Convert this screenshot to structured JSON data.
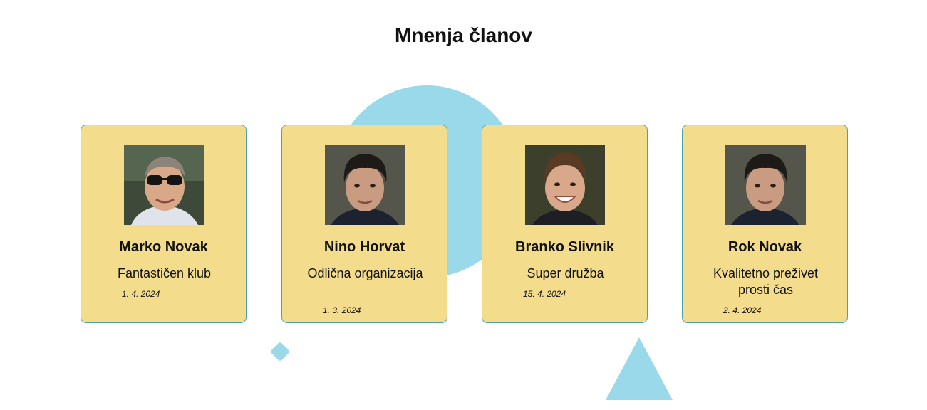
{
  "section": {
    "title": "Mnenja članov"
  },
  "testimonials": [
    {
      "name": "Marko Novak",
      "comment": "Fantastičen klub",
      "date": "1. 4. 2024",
      "photo_icon": "man-with-sunglasses-photo"
    },
    {
      "name": "Nino Horvat",
      "comment": "Odlična organizacija",
      "date": "1. 3. 2024",
      "photo_icon": "young-man-photo"
    },
    {
      "name": "Branko Slivnik",
      "comment": "Super družba",
      "date": "15. 4. 2024",
      "photo_icon": "smiling-boy-photo"
    },
    {
      "name": "Rok Novak",
      "comment": "Kvalitetno preživet prosti čas",
      "date": "2. 4. 2024",
      "photo_icon": "young-man-photo"
    }
  ],
  "colors": {
    "card_background": "#f4dc8d",
    "card_border": "#4aa3a8",
    "decoration": "#99d9ea"
  }
}
